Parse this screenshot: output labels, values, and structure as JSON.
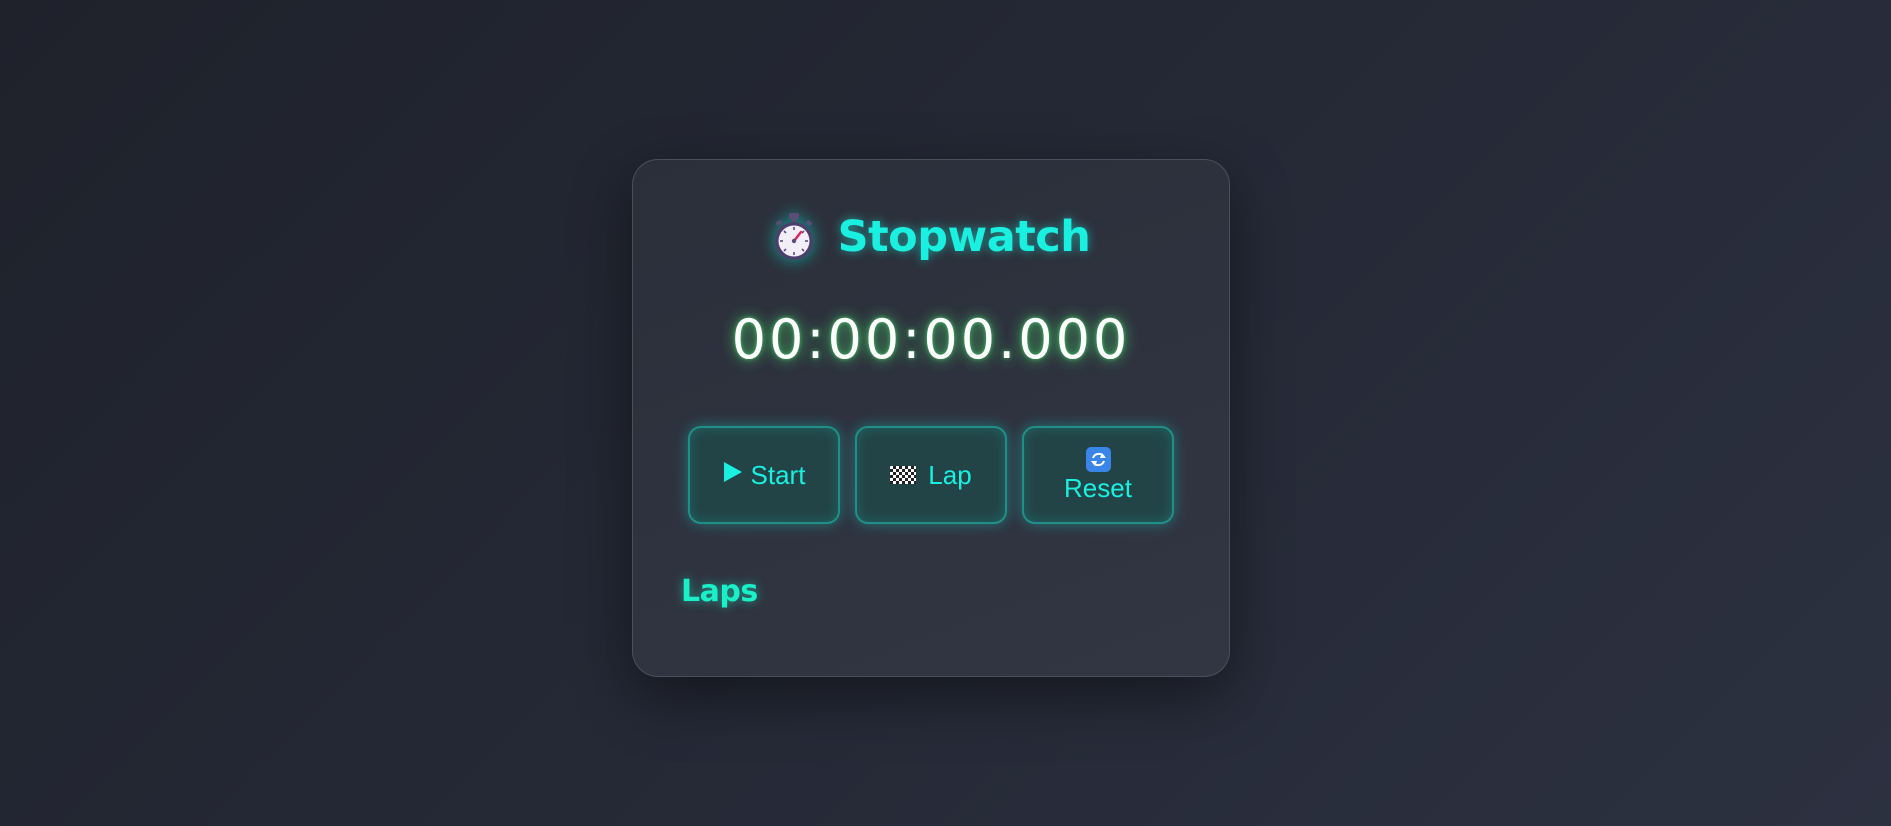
{
  "app": {
    "title": "Stopwatch",
    "icon": "stopwatch-icon"
  },
  "display": {
    "time": "00:00:00.000"
  },
  "controls": {
    "start_label": "Start",
    "start_icon": "play-icon",
    "lap_label": "Lap",
    "lap_icon": "checkered-flag-icon",
    "reset_label": "Reset",
    "reset_icon": "refresh-icon"
  },
  "laps": {
    "heading": "Laps",
    "items": []
  },
  "colors": {
    "accent": "#19f0e0",
    "time_glow": "#50ff78",
    "button_bg": "#234446",
    "button_border": "#1f8f88",
    "card_bg": "#2f3340",
    "page_bg": "#252936"
  }
}
